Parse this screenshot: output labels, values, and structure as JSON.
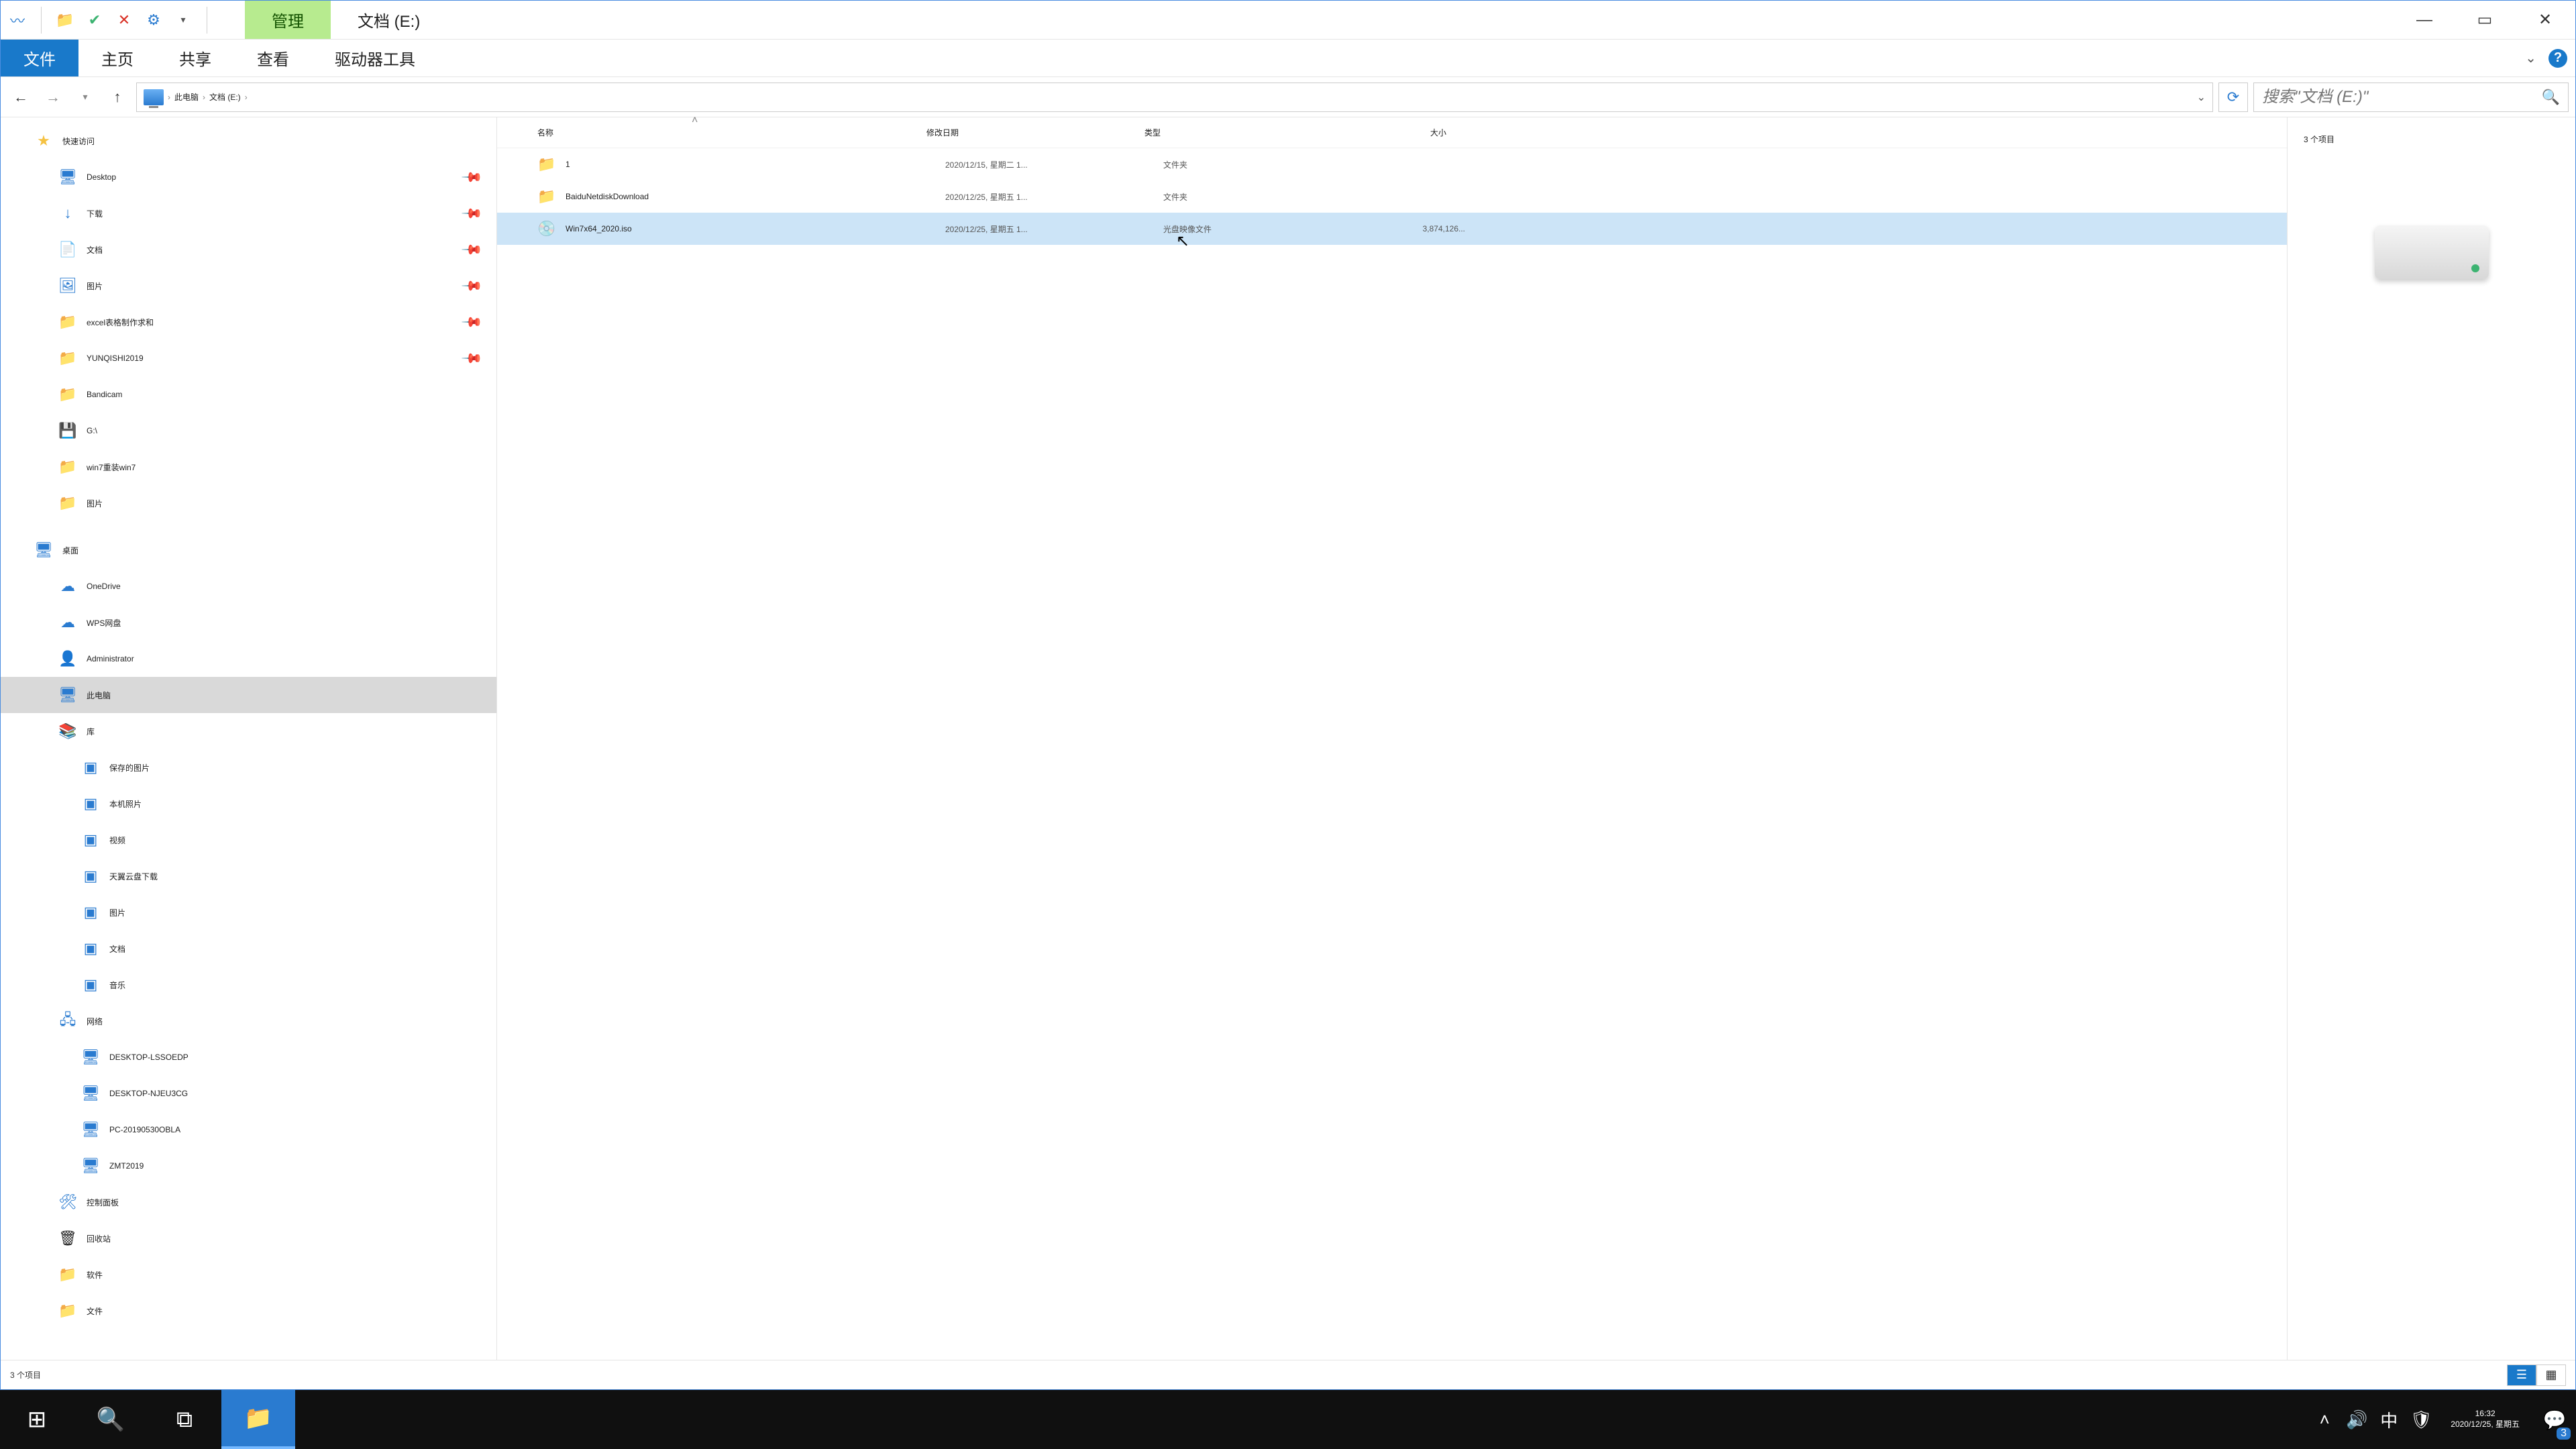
{
  "titlebar": {
    "manage": "管理",
    "path_label": "文档 (E:)"
  },
  "ribbon": {
    "file": "文件",
    "home": "主页",
    "share": "共享",
    "view": "查看",
    "drive_tools": "驱动器工具"
  },
  "breadcrumb": {
    "this_pc": "此电脑",
    "drive": "文档 (E:)"
  },
  "search": {
    "placeholder": "搜索\"文档 (E:)\""
  },
  "sidebar": {
    "quick_access": "快速访问",
    "qa_items": [
      {
        "label": "Desktop",
        "icon": "🖥",
        "color": "blue-i"
      },
      {
        "label": "下载",
        "icon": "↓",
        "color": "blue-i"
      },
      {
        "label": "文档",
        "icon": "📄",
        "color": "folder-y"
      },
      {
        "label": "图片",
        "icon": "🖼",
        "color": "blue-i"
      },
      {
        "label": "excel表格制作求和",
        "icon": "📁",
        "color": "folder-y"
      },
      {
        "label": "YUNQISHI2019",
        "icon": "📁",
        "color": "folder-y"
      },
      {
        "label": "Bandicam",
        "icon": "📁",
        "color": "folder-y"
      },
      {
        "label": "G:\\",
        "icon": "💾",
        "color": "blue-i"
      },
      {
        "label": "win7重装win7",
        "icon": "📁",
        "color": "folder-y"
      },
      {
        "label": "图片",
        "icon": "📁",
        "color": "folder-y"
      }
    ],
    "desktop": "桌面",
    "onedrive": "OneDrive",
    "wps": "WPS网盘",
    "admin": "Administrator",
    "this_pc": "此电脑",
    "libraries": "库",
    "lib_items": [
      "保存的图片",
      "本机照片",
      "视频",
      "天翼云盘下载",
      "图片",
      "文档",
      "音乐"
    ],
    "network": "网络",
    "net_items": [
      "DESKTOP-LSSOEDP",
      "DESKTOP-NJEU3CG",
      "PC-20190530OBLA",
      "ZMT2019"
    ],
    "control_panel": "控制面板",
    "recycle": "回收站",
    "software": "软件",
    "files": "文件"
  },
  "columns": {
    "name": "名称",
    "date": "修改日期",
    "type": "类型",
    "size": "大小"
  },
  "rows": [
    {
      "icon": "📁",
      "name": "1",
      "date": "2020/12/15, 星期二 1...",
      "type": "文件夹",
      "size": ""
    },
    {
      "icon": "📁",
      "name": "BaiduNetdiskDownload",
      "date": "2020/12/25, 星期五 1...",
      "type": "文件夹",
      "size": ""
    },
    {
      "icon": "💿",
      "name": "Win7x64_2020.iso",
      "date": "2020/12/25, 星期五 1...",
      "type": "光盘映像文件",
      "size": "3,874,126..."
    }
  ],
  "preview": {
    "count": "3 个项目"
  },
  "statusbar": {
    "text": "3 个项目"
  },
  "taskbar": {
    "time": "16:32",
    "date": "2020/12/25, 星期五",
    "ime": "中",
    "notif_count": "3"
  }
}
